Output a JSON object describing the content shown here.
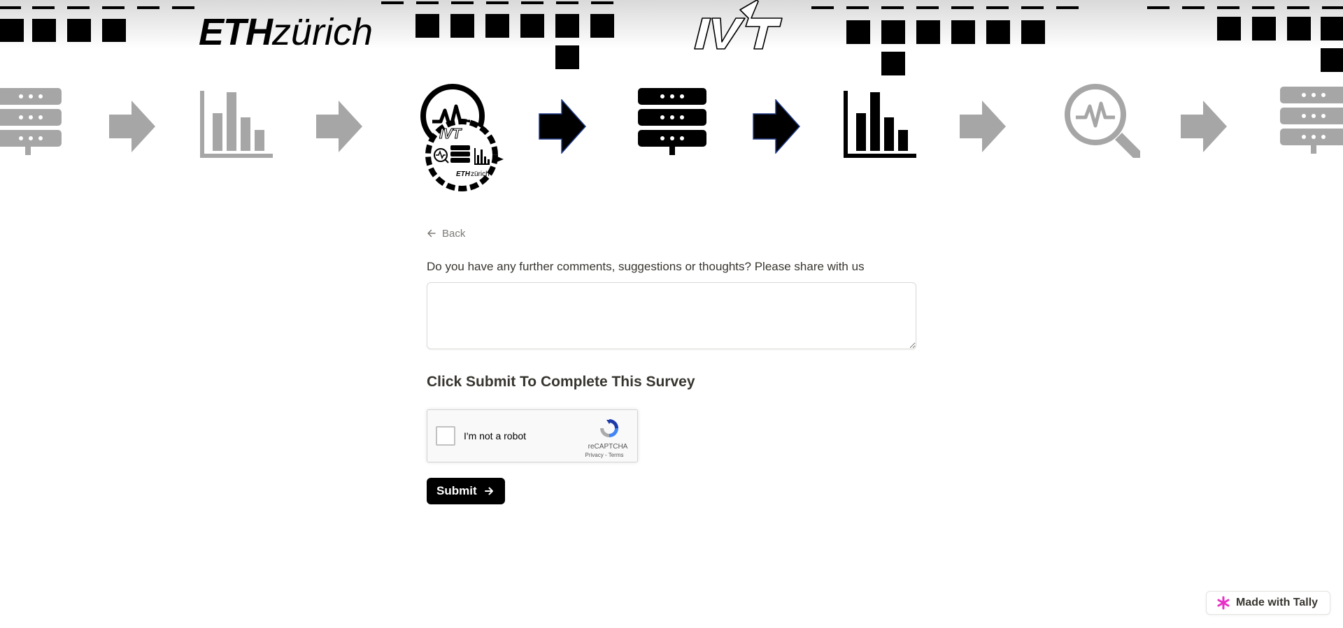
{
  "banner": {
    "eth_logo": {
      "bold": "ETH",
      "light": "zürich"
    },
    "ivt_logo": "IVT",
    "badge": {
      "eth": "ETH",
      "zurich": "zürich"
    },
    "icons": [
      "server-icon",
      "arrow-right-icon",
      "bar-chart-icon",
      "arrow-right-icon",
      "project-logo-icon",
      "arrow-right-icon",
      "server-icon",
      "arrow-right-icon",
      "bar-chart-icon",
      "arrow-right-icon",
      "search-pulse-icon",
      "arrow-right-icon",
      "server-icon"
    ],
    "colors": {
      "dark": "#000000",
      "faded": "#a6a6a6",
      "arrow_outline": "#1f3a8a"
    }
  },
  "form": {
    "back_label": "Back",
    "question": "Do you have any further comments, suggestions or thoughts? Please share with us",
    "answer_value": "",
    "section_title": "Click Submit To Complete This Survey",
    "recaptcha": {
      "label": "I'm not a robot",
      "brand": "reCAPTCHA",
      "links": "Privacy - Terms"
    },
    "submit_label": "Submit"
  },
  "footer": {
    "tally_label": "Made with Tally",
    "tally_color": "#e830c8"
  }
}
